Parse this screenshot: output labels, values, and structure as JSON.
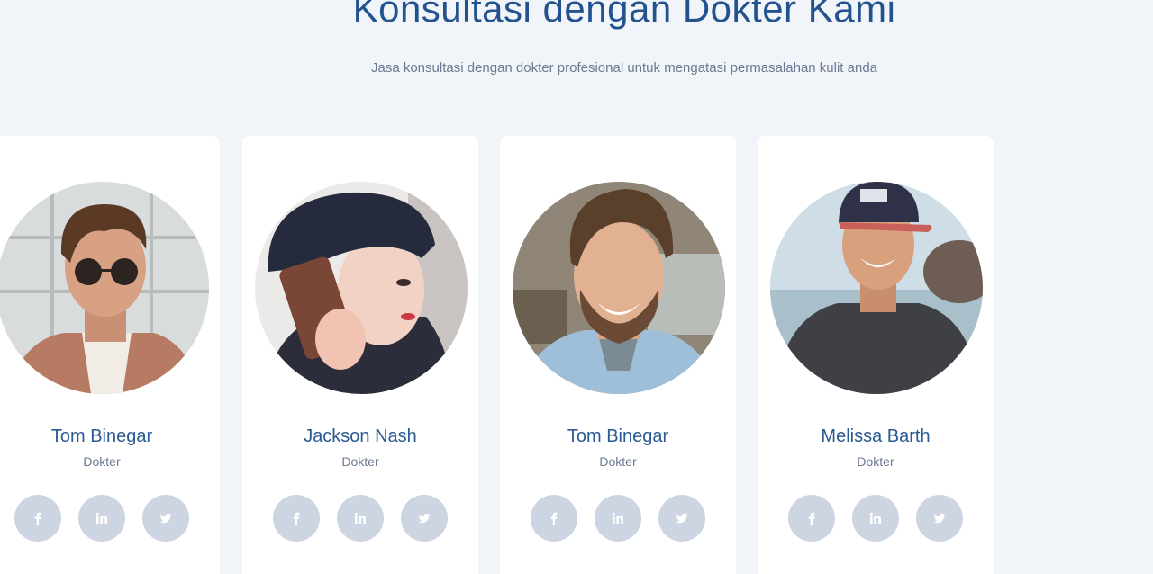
{
  "section": {
    "title": "Konsultasi dengan Dokter Kami",
    "subtitle": "Jasa konsultasi dengan dokter profesional untuk mengatasi permasalahan kulit anda"
  },
  "doctors": [
    {
      "name": "Tom Binegar",
      "role": "Dokter"
    },
    {
      "name": "Jackson Nash",
      "role": "Dokter"
    },
    {
      "name": "Tom Binegar",
      "role": "Dokter"
    },
    {
      "name": "Melissa Barth",
      "role": "Dokter"
    }
  ],
  "social_icons": [
    "facebook-icon",
    "linkedin-icon",
    "twitter-icon"
  ],
  "colors": {
    "background": "#f1f5f9",
    "title": "#23538f",
    "name": "#2a5a93",
    "muted": "#6b7a90",
    "social_bg": "#ccd5e1",
    "card": "#ffffff"
  }
}
